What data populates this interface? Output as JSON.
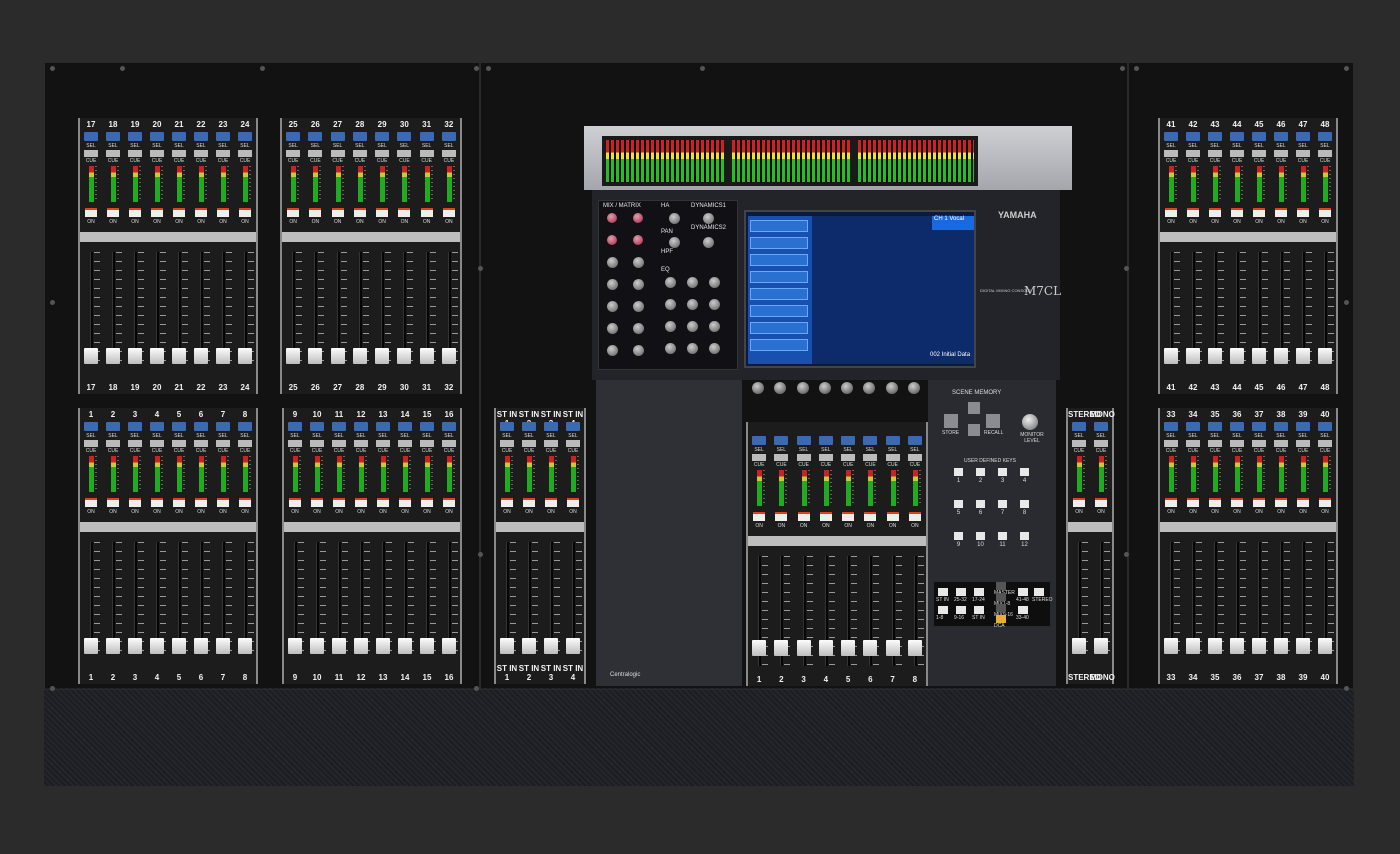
{
  "brand": {
    "maker": "YAMAHA",
    "model": "M7CL",
    "subtitle": "DIGITAL MIXING CONSOLE",
    "centralogic": "Centralogic"
  },
  "bays": {
    "top_left_a": [
      "17",
      "18",
      "19",
      "20",
      "21",
      "22",
      "23",
      "24"
    ],
    "top_left_b": [
      "25",
      "26",
      "27",
      "28",
      "29",
      "30",
      "31",
      "32"
    ],
    "bottom_left_a": [
      "1",
      "2",
      "3",
      "4",
      "5",
      "6",
      "7",
      "8"
    ],
    "bottom_left_b": [
      "9",
      "10",
      "11",
      "12",
      "13",
      "14",
      "15",
      "16"
    ],
    "st_in": [
      "ST IN 1",
      "ST IN 2",
      "ST IN 3",
      "ST IN 4"
    ],
    "st_in_bottom": [
      "ST IN 1",
      "ST IN 2",
      "ST IN 3",
      "ST IN 4"
    ],
    "centralogic": [
      "1",
      "2",
      "3",
      "4",
      "5",
      "6",
      "7",
      "8"
    ],
    "top_right": [
      "41",
      "42",
      "43",
      "44",
      "45",
      "46",
      "47",
      "48"
    ],
    "bottom_right": [
      "33",
      "34",
      "35",
      "36",
      "37",
      "38",
      "39",
      "40"
    ],
    "master": [
      "STEREO",
      "MONO"
    ]
  },
  "strip_labels": {
    "sel": "SEL",
    "cue": "CUE",
    "on": "ON"
  },
  "selected_channel": {
    "mix_matrix": "MIX / MATRIX",
    "ha": "HA",
    "dynamics1": "DYNAMICS1",
    "dynamics2": "DYNAMICS2",
    "pan": "PAN",
    "hpf": "HPF",
    "eq": "EQ"
  },
  "screen": {
    "channel_title": "CH 1",
    "channel_name": "Vocal",
    "scene_number": "002",
    "scene_name": "Initial Data"
  },
  "scene_memory": {
    "label": "SCENE MEMORY",
    "store": "STORE",
    "recall": "RECALL"
  },
  "monitor": {
    "label": "MONITOR LEVEL"
  },
  "user_defined_keys": {
    "label": "USER DEFINED KEYS",
    "keys": [
      "1",
      "2",
      "3",
      "4",
      "5",
      "6",
      "7",
      "8",
      "9",
      "10",
      "11",
      "12"
    ]
  },
  "layer_keys": {
    "left": [
      "ST IN",
      "25-32",
      "17-24",
      "1-8",
      "9-16",
      "ST IN"
    ],
    "center": [
      "MASTER",
      "MIX1-8",
      "MIX9-16",
      "DCA"
    ],
    "right": [
      "41-48",
      "STEREO",
      "33-40"
    ]
  },
  "colors": {
    "sel_blue": "#3a6ab0",
    "on_red": "#e04020",
    "screen_blue": "#1850b0",
    "dca_yellow": "#e8b030",
    "stereo_red": "#d03030"
  }
}
